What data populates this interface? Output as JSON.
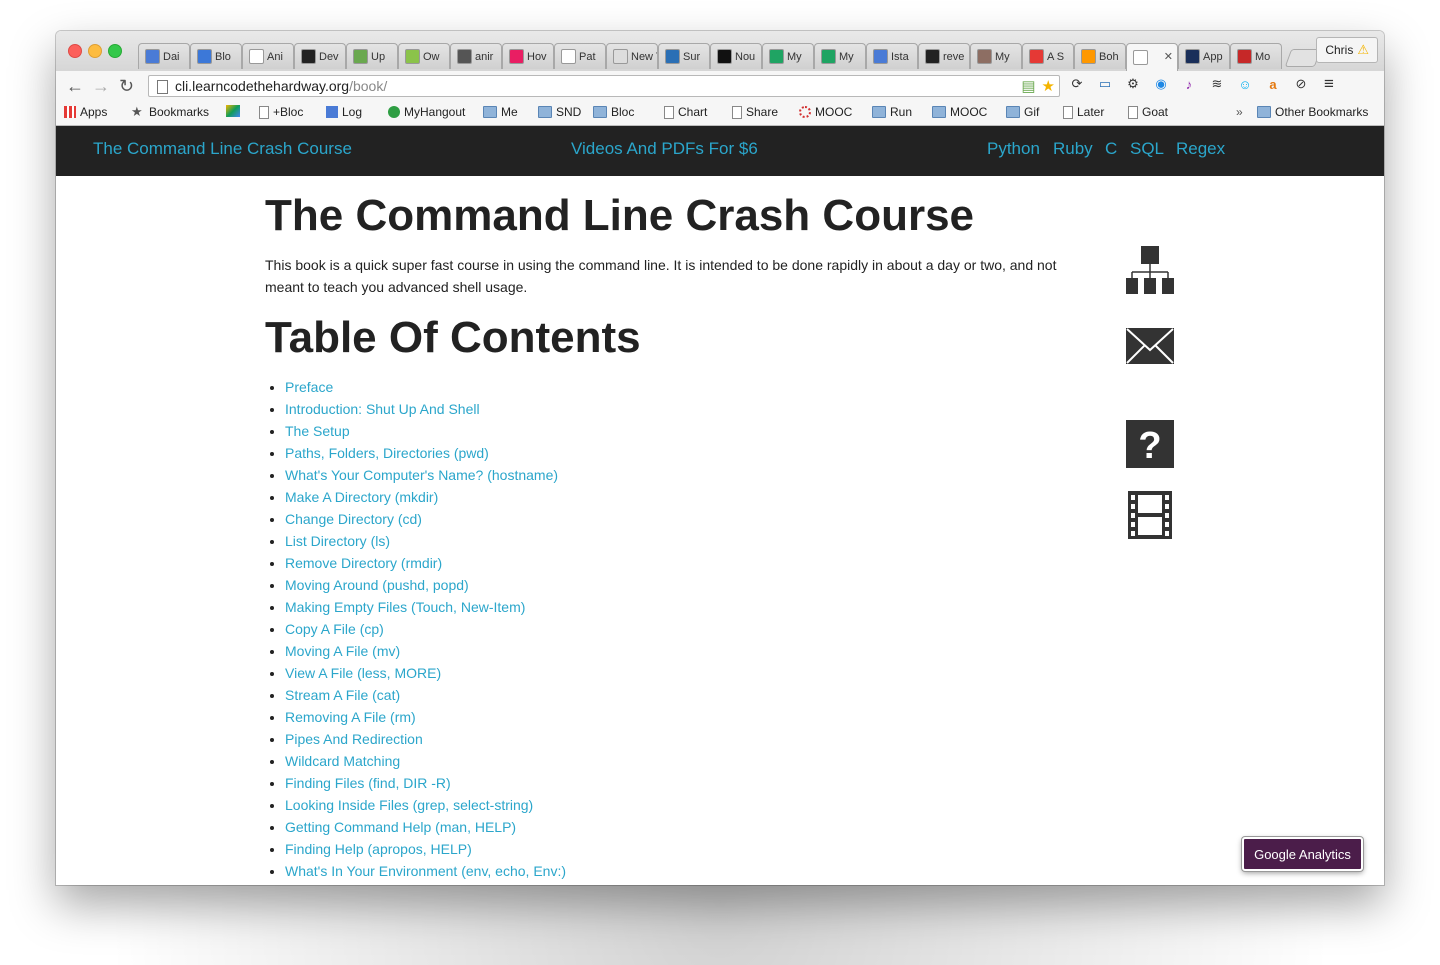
{
  "browser": {
    "tabs": [
      {
        "label": "Dai",
        "color": "#4a7bd6"
      },
      {
        "label": "Blo",
        "color": "#3c78d8"
      },
      {
        "label": "Ani",
        "color": "#ffffff"
      },
      {
        "label": "Dev",
        "color": "#222222"
      },
      {
        "label": "Up",
        "color": "#6aa84f"
      },
      {
        "label": "Ow",
        "color": "#8bc34a"
      },
      {
        "label": "anir",
        "color": "#555555"
      },
      {
        "label": "Hov",
        "color": "#e91e63"
      },
      {
        "label": "Pat",
        "color": "#ffffff"
      },
      {
        "label": "New T",
        "color": "#dddddd"
      },
      {
        "label": "Sur",
        "color": "#2a6fb5"
      },
      {
        "label": "Nou",
        "color": "#111111"
      },
      {
        "label": "My",
        "color": "#1fa463"
      },
      {
        "label": "My",
        "color": "#1fa463"
      },
      {
        "label": "Ista",
        "color": "#4a7bd6"
      },
      {
        "label": "reve",
        "color": "#222222"
      },
      {
        "label": "My",
        "color": "#8d6e63"
      },
      {
        "label": "A S",
        "color": "#e53935"
      },
      {
        "label": "Boh",
        "color": "#ff9800"
      },
      {
        "label": "",
        "color": "#ffffff"
      },
      {
        "label": "App",
        "color": "#1a2f5a"
      },
      {
        "label": "Mo",
        "color": "#c62828"
      }
    ],
    "active_tab_index": 19,
    "profile_name": "Chris",
    "url_host": "cli.learncodethehardway.org",
    "url_path": "/book/",
    "bookmarks": [
      {
        "label": "Apps",
        "type": "apps"
      },
      {
        "label": "Bookmarks",
        "type": "star"
      },
      {
        "label": "",
        "type": "drive"
      },
      {
        "label": "+Bloc",
        "type": "page"
      },
      {
        "label": "Log",
        "type": "doc"
      },
      {
        "label": "MyHangout",
        "type": "hangout"
      },
      {
        "label": "Me",
        "type": "folder"
      },
      {
        "label": "SND",
        "type": "folder"
      },
      {
        "label": "Bloc",
        "type": "folder"
      },
      {
        "label": "Chart",
        "type": "page"
      },
      {
        "label": "Share",
        "type": "page"
      },
      {
        "label": "MOOC",
        "type": "mooc"
      },
      {
        "label": "Run",
        "type": "folder"
      },
      {
        "label": "MOOC",
        "type": "folder"
      },
      {
        "label": "Gif",
        "type": "folder"
      },
      {
        "label": "Later",
        "type": "page"
      },
      {
        "label": "Goat",
        "type": "page"
      }
    ],
    "overflow_label": "»",
    "other_bookmarks": "Other Bookmarks"
  },
  "site": {
    "nav": {
      "brand": "The Command Line Crash Course",
      "promo": "Videos And PDFs For $6",
      "links": [
        "Python",
        "Ruby",
        "C",
        "SQL",
        "Regex"
      ]
    },
    "title": "The Command Line Crash Course",
    "intro": "This book is a quick super fast course in using the command line. It is intended to be done rapidly in about a day or two, and not meant to teach you advanced shell usage.",
    "toc_heading": "Table Of Contents",
    "toc": [
      "Preface",
      "Introduction: Shut Up And Shell",
      "The Setup",
      "Paths, Folders, Directories (pwd)",
      "What's Your Computer's Name? (hostname)",
      "Make A Directory (mkdir)",
      "Change Directory (cd)",
      "List Directory (ls)",
      "Remove Directory (rmdir)",
      "Moving Around (pushd, popd)",
      "Making Empty Files (Touch, New-Item)",
      "Copy A File (cp)",
      "Moving A File (mv)",
      "View A File (less, MORE)",
      "Stream A File (cat)",
      "Removing A File (rm)",
      "Pipes And Redirection",
      "Wildcard Matching",
      "Finding Files (find, DIR -R)",
      "Looking Inside Files (grep, select-string)",
      "Getting Command Help (man, HELP)",
      "Finding Help (apropos, HELP)",
      "What's In Your Environment (env, echo, Env:)"
    ],
    "side_icons": [
      "sitemap-icon",
      "mail-icon",
      "help-icon",
      "film-icon"
    ],
    "analytics_button": "Google Analytics",
    "link_color": "#2ba6cb",
    "nav_bg": "#222222"
  }
}
